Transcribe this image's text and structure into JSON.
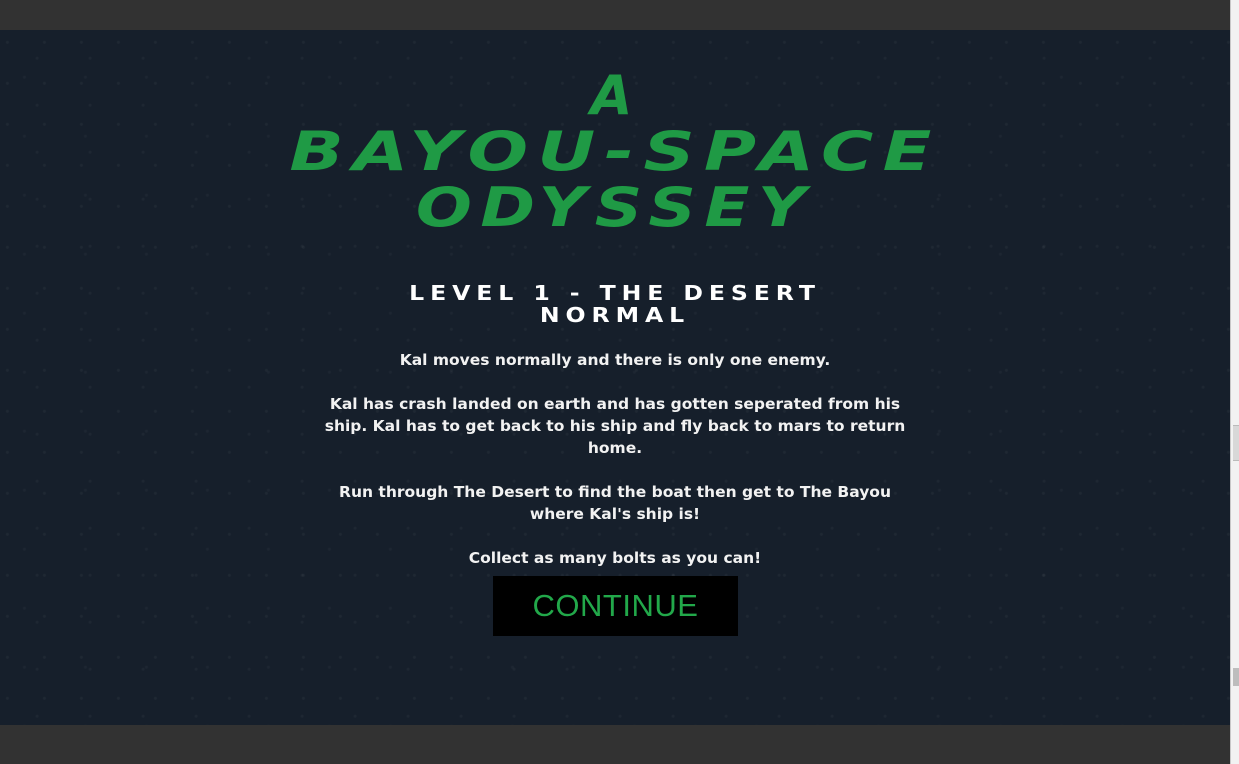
{
  "title": {
    "line1": "A",
    "line2": "Bayou-Space",
    "line3": "Odyssey"
  },
  "level": {
    "heading": "Level 1 - The Desert",
    "difficulty": "Normal"
  },
  "description": {
    "p1": "Kal moves normally and there is only one enemy.",
    "p2": "Kal has crash landed on earth and has gotten seperated from his ship. Kal has to get back to his ship and fly back to mars to return home.",
    "p3": "Run through The Desert to find the boat then get to The Bayou where Kal's ship is!",
    "p4": "Collect as many bolts as you can!"
  },
  "continue_button": {
    "label": "CONTINUE"
  },
  "colors": {
    "title_green": "#1f9a45",
    "button_text_green": "#22a84a",
    "screen_background": "#161f2b",
    "button_background": "#000000",
    "frame_gray": "#323232"
  }
}
